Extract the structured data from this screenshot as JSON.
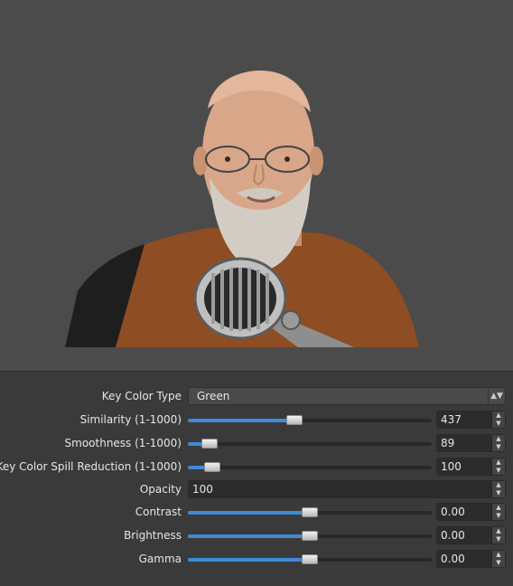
{
  "preview": {
    "icon": "person-with-microphone"
  },
  "controls": {
    "key_color_type": {
      "label": "Key Color Type",
      "value": "Green",
      "arrow_icon": "chevron-updown-icon"
    },
    "similarity": {
      "label": "Similarity (1-1000)",
      "value": "437",
      "fraction": 0.437
    },
    "smoothness": {
      "label": "Smoothness (1-1000)",
      "value": "89",
      "fraction": 0.089
    },
    "spill_reduction": {
      "label": "Key Color Spill Reduction (1-1000)",
      "value": "100",
      "fraction": 0.1
    },
    "opacity": {
      "label": "Opacity",
      "value": "100"
    },
    "contrast": {
      "label": "Contrast",
      "value": "0.00",
      "fraction": 0.5
    },
    "brightness": {
      "label": "Brightness",
      "value": "0.00",
      "fraction": 0.5
    },
    "gamma": {
      "label": "Gamma",
      "value": "0.00",
      "fraction": 0.5
    }
  },
  "colors": {
    "accent": "#3e8ad6",
    "panel": "#3a3a3a",
    "preview_bg": "#4b4b4b"
  }
}
